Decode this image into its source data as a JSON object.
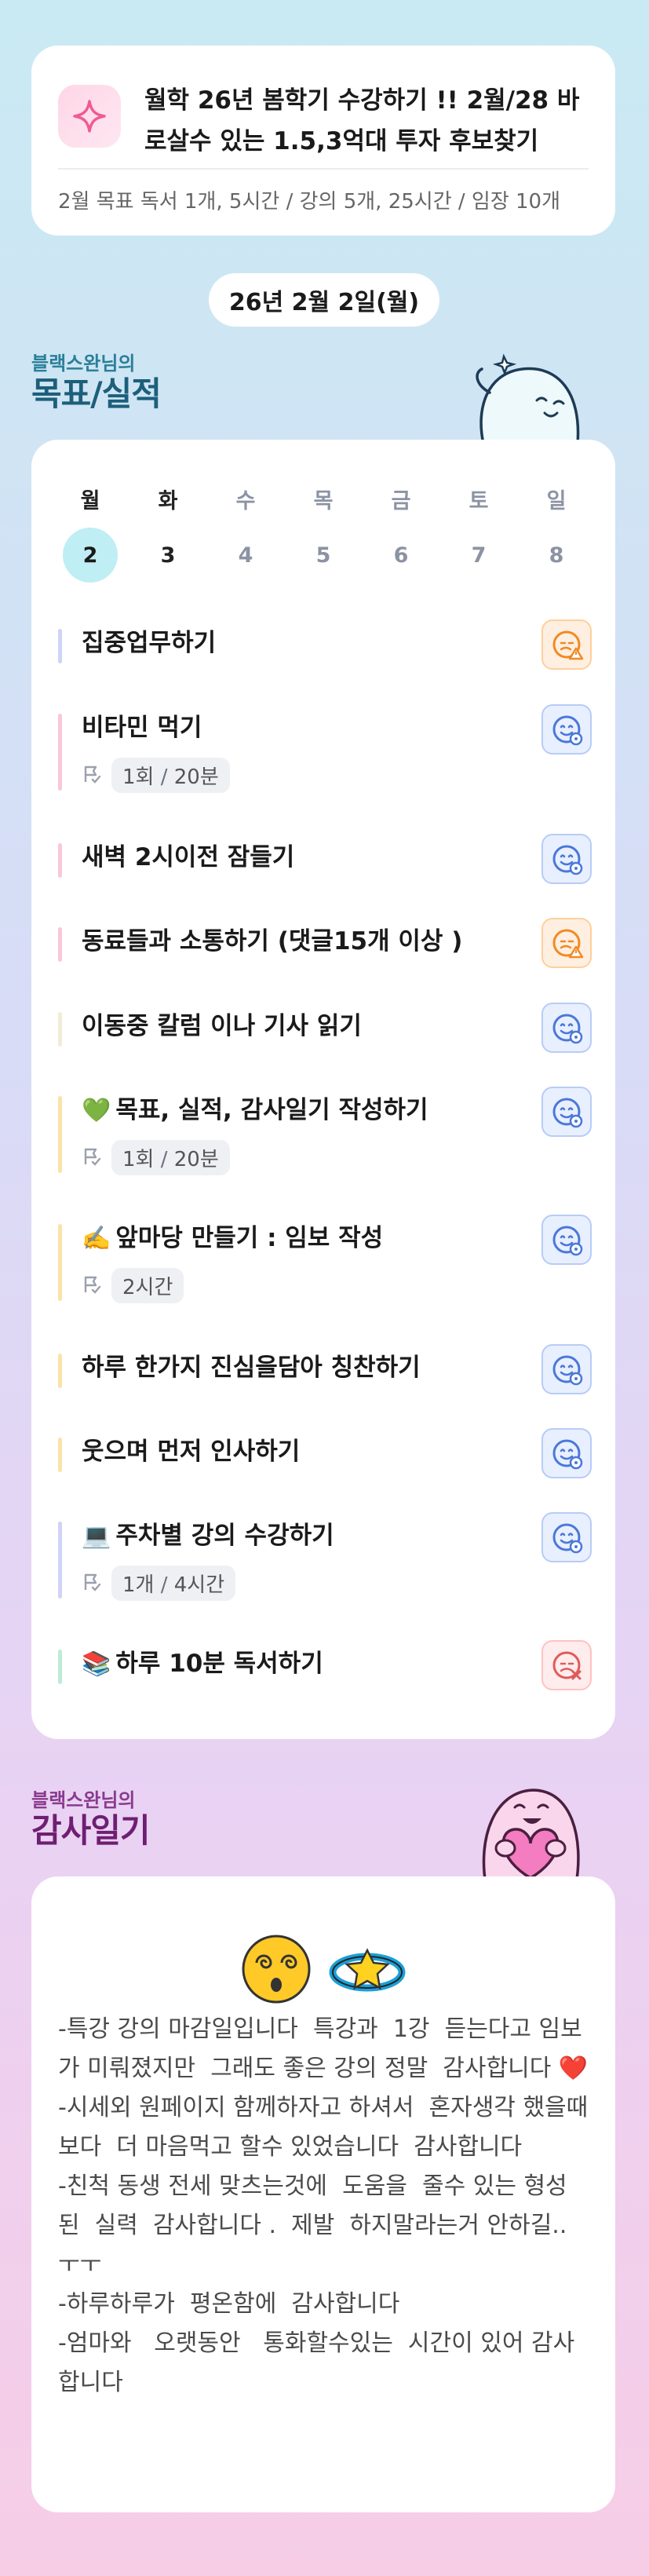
{
  "goal": {
    "title": "월학 26년 봄학기 수강하기 !! 2월/28 바로살수 있는 1.5,3억대 투자 후보찾기",
    "subtitle": "2월 목표  독서 1개, 5시간 / 강의 5개, 25시간 / 임장 10개"
  },
  "date": "26년 2월 2일(월)",
  "tasks_section": {
    "owner": "블랙스완님의",
    "title": "목표/실적"
  },
  "week": [
    {
      "label": "월",
      "num": "2"
    },
    {
      "label": "화",
      "num": "3"
    },
    {
      "label": "수",
      "num": "4"
    },
    {
      "label": "목",
      "num": "5"
    },
    {
      "label": "금",
      "num": "6"
    },
    {
      "label": "토",
      "num": "7"
    },
    {
      "label": "일",
      "num": "8"
    }
  ],
  "tasks": [
    {
      "emoji": "",
      "name": "집중업무하기",
      "count": "",
      "unit": "",
      "status": "warning",
      "bar": "#cfd3f5"
    },
    {
      "emoji": "",
      "name": "비타민 먹기",
      "count": "1회",
      "unit": "20분",
      "status": "done",
      "bar": "#f9c8d8"
    },
    {
      "emoji": "",
      "name": "새벽 2시이전 잠들기",
      "count": "",
      "unit": "",
      "status": "done",
      "bar": "#f9c8d8"
    },
    {
      "emoji": "",
      "name": "동료들과 소통하기 (댓글15개 이상 )",
      "count": "",
      "unit": "",
      "status": "warning",
      "bar": "#f9c8d8"
    },
    {
      "emoji": "",
      "name": "이동중 칼럼 이나 기사 읽기",
      "count": "",
      "unit": "",
      "status": "done",
      "bar": "#f2ecd7"
    },
    {
      "emoji": "💚",
      "name": "목표, 실적, 감사일기 작성하기",
      "count": "1회",
      "unit": "20분",
      "status": "done",
      "bar": "#fbe3a8"
    },
    {
      "emoji": "✍️",
      "name": "앞마당 만들기 : 임보 작성",
      "count": "2시간",
      "unit": "",
      "status": "done",
      "bar": "#fbe3a8"
    },
    {
      "emoji": "",
      "name": "하루 한가지 진심을담아 칭찬하기",
      "count": "",
      "unit": "",
      "status": "done",
      "bar": "#fbe3a8"
    },
    {
      "emoji": "",
      "name": "웃으며 먼저 인사하기",
      "count": "",
      "unit": "",
      "status": "done",
      "bar": "#fbe3a8"
    },
    {
      "emoji": "💻",
      "name": "주차별 강의 수강하기",
      "count": "1개",
      "unit": "4시간",
      "status": "done",
      "bar": "#cfd3f5"
    },
    {
      "emoji": "📚",
      "name": "하루 10분 독서하기",
      "count": "",
      "unit": "",
      "status": "failed",
      "bar": "#bdebd6"
    }
  ],
  "diary_section": {
    "owner": "블랙스완님의",
    "title": "감사일기"
  },
  "diary": {
    "emojis": [
      "😵‍💫",
      "💫"
    ],
    "text": "-특강 강의 마감일입니다  특강과  1강  듣는다고 임보가 미뤄졌지만  그래도 좋은 강의 정말  감사합니다 ❤️\n-시세외 원페이지 함께하자고 하셔서  혼자생각 했을때 보다  더 마음먹고 할수 있었습니다  감사합니다\n-친척 동생 전세 맞츠는것에  도움을  줄수 있는 형성된  실력  감사합니다 .  제발  하지말라는거 안하길.. ㅜㅜ\n-하루하루가  평온함에  감사합니다\n-엄마와   오랫동안   통화할수있는  시간이 있어 감사합니다"
  },
  "colors": {
    "accent_teal": "#bfeef4",
    "status_blue": "#4a78d9",
    "status_orange": "#f08a24",
    "status_red": "#e05a5a"
  }
}
